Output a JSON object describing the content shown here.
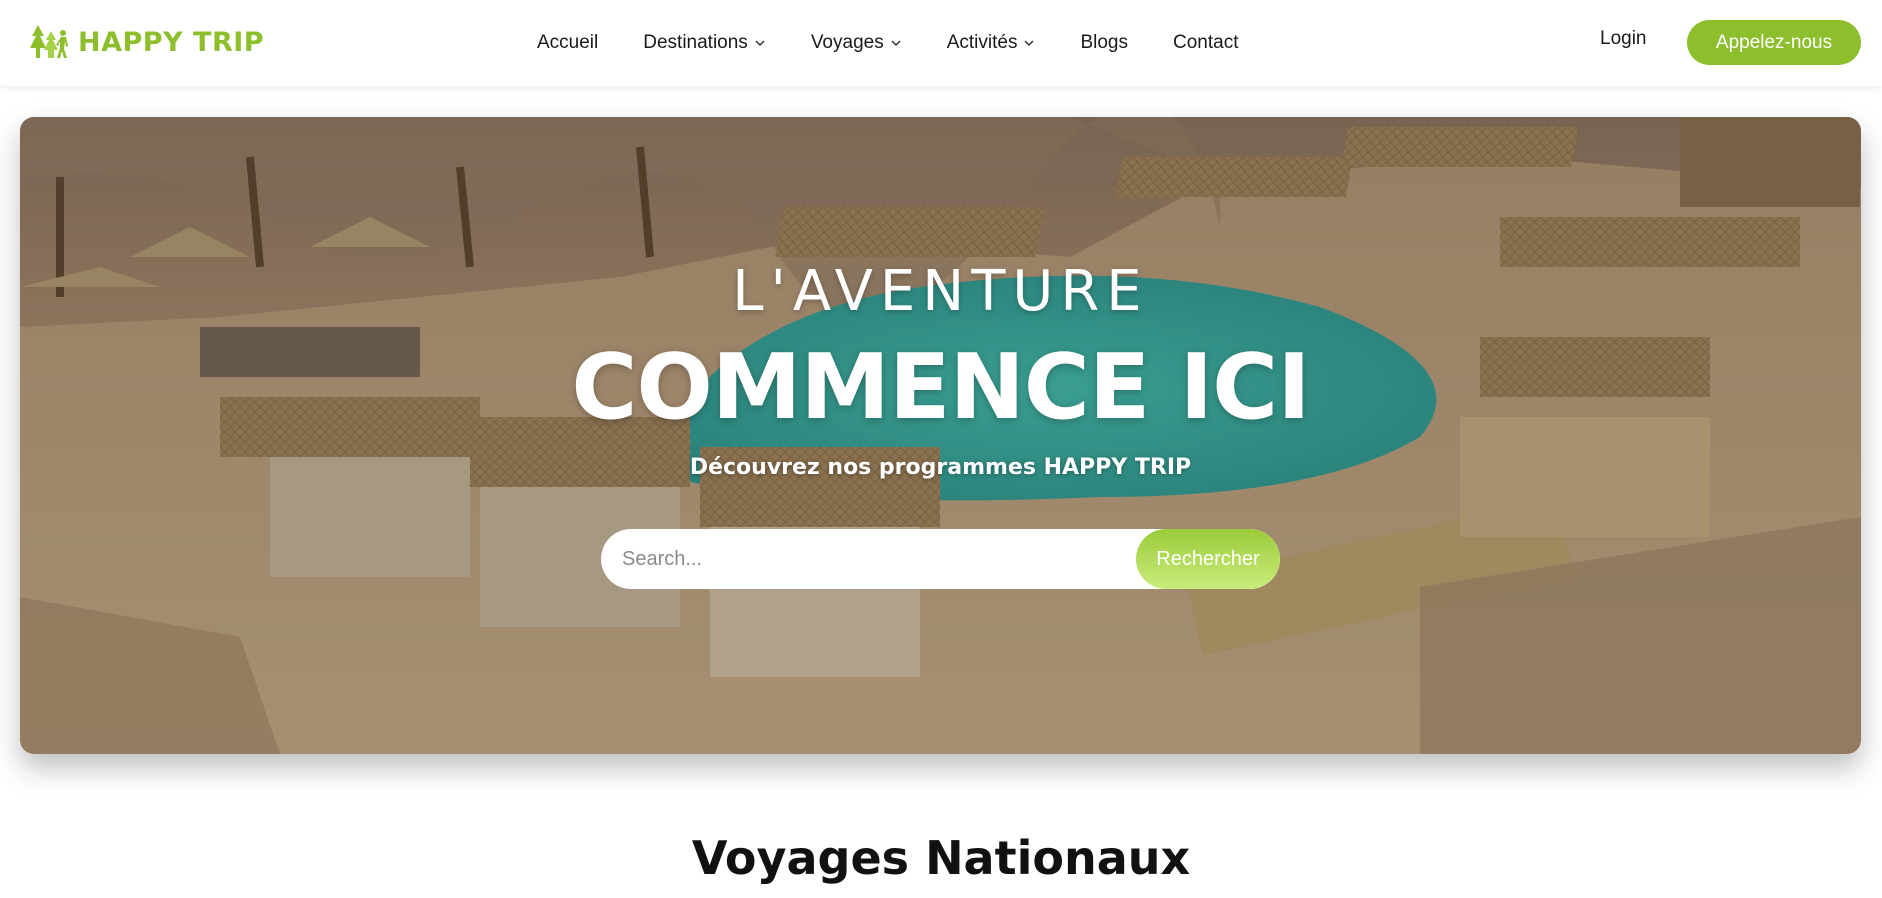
{
  "brand": {
    "name": "HAPPY TRIP",
    "color": "#8dbf2c",
    "logo_icon": "trees-hikers-icon"
  },
  "nav": {
    "items": [
      {
        "label": "Accueil",
        "dropdown": false
      },
      {
        "label": "Destinations",
        "dropdown": true
      },
      {
        "label": "Voyages",
        "dropdown": true
      },
      {
        "label": "Activités",
        "dropdown": true
      },
      {
        "label": "Blogs",
        "dropdown": false
      },
      {
        "label": "Contact",
        "dropdown": false
      }
    ],
    "login_label": "Login",
    "cta_label": "Appelez-nous"
  },
  "hero": {
    "subtitle": "L'AVENTURE",
    "title": "COMMENCE ICI",
    "description": "Découvrez nos programmes HAPPY TRIP",
    "search_placeholder": "Search...",
    "search_value": "",
    "search_button": "Rechercher",
    "image": "desert resort with pool and straw-roof cabanas"
  },
  "section": {
    "title": "Voyages Nationaux"
  },
  "colors": {
    "accent": "#8dbf2c",
    "accent_light": "#c9ec7b",
    "text": "#111111"
  }
}
